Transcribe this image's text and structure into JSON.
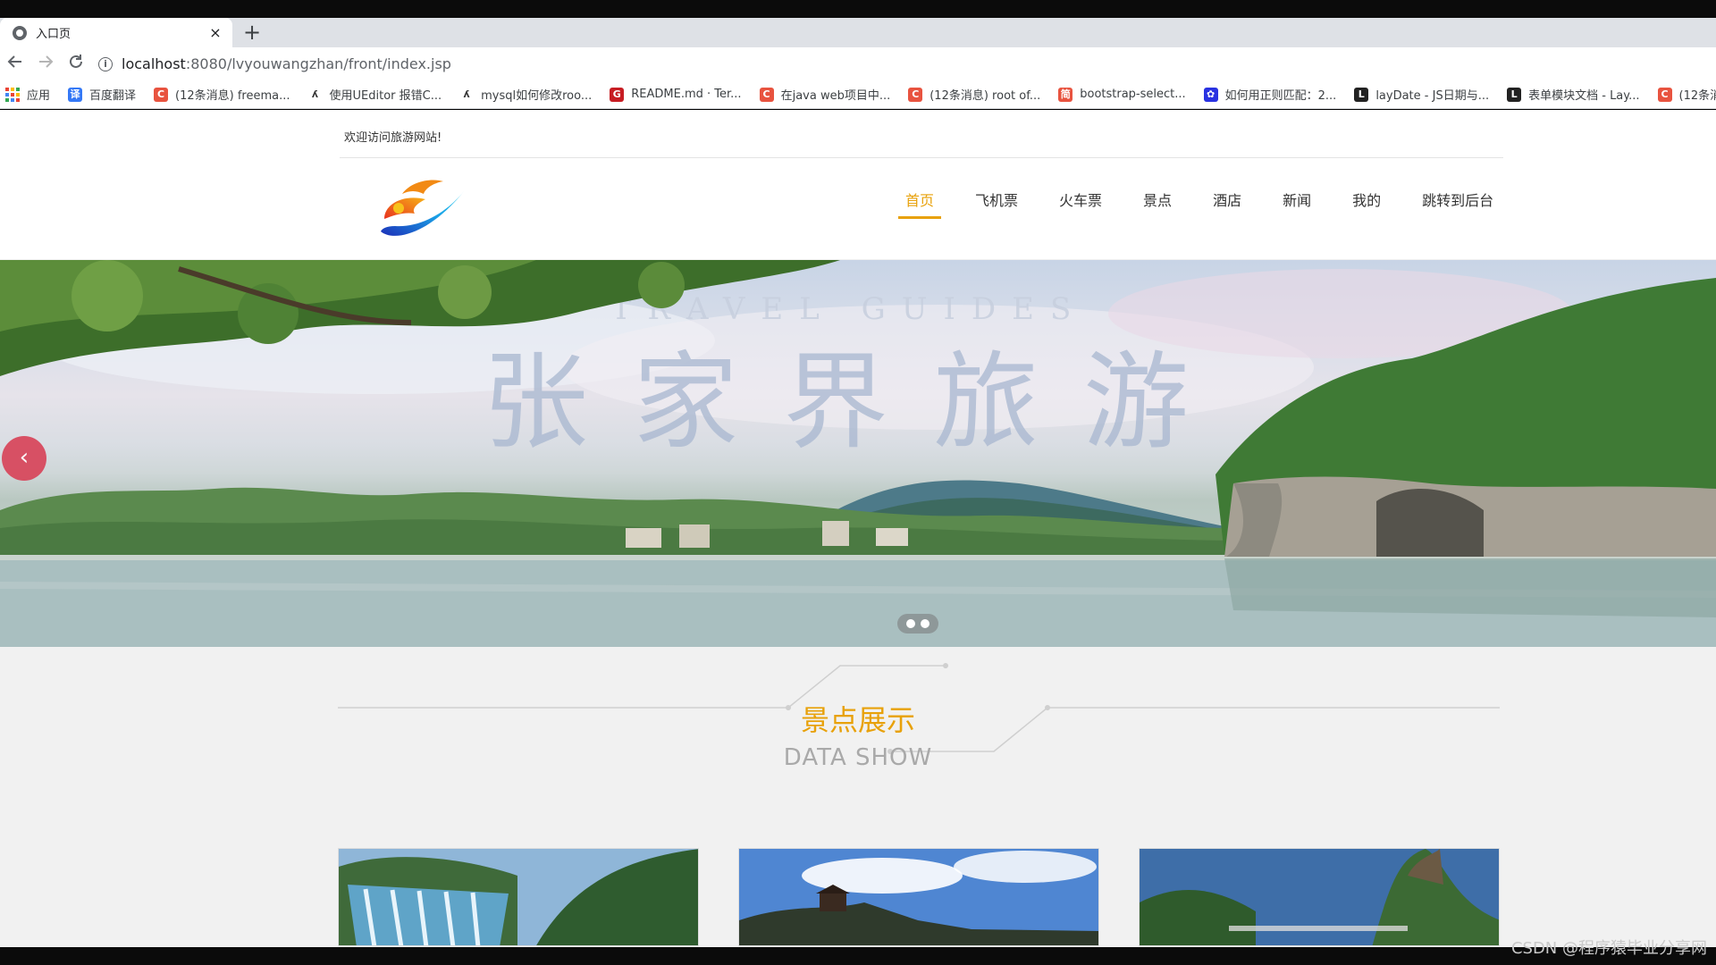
{
  "browser": {
    "tab_title": "入口页",
    "tab_close": "×",
    "new_tab": "+",
    "url_host": "localhost",
    "url_path": ":8080/lvyouwangzhan/front/index.jsp",
    "bookmarks": [
      {
        "label": "应用",
        "icon": "apps-icon"
      },
      {
        "label": "百度翻译",
        "icon": "baidu-translate-icon",
        "color": "#3478f6",
        "glyph": "译"
      },
      {
        "label": "(12条消息) freema...",
        "icon": "csdn-icon",
        "color": "#e8533f",
        "glyph": "C"
      },
      {
        "label": "使用UEditor 报错C...",
        "icon": "blog-icon",
        "color": "#ffffff",
        "glyph": "ʎ"
      },
      {
        "label": "mysql如何修改roo...",
        "icon": "blog-icon",
        "color": "#ffffff",
        "glyph": "ʎ"
      },
      {
        "label": "README.md · Ter...",
        "icon": "gitee-icon",
        "color": "#c71d23",
        "glyph": "G"
      },
      {
        "label": "在java web项目中...",
        "icon": "csdn-icon",
        "color": "#e8533f",
        "glyph": "C"
      },
      {
        "label": "(12条消息) root of...",
        "icon": "csdn-icon",
        "color": "#e8533f",
        "glyph": "C"
      },
      {
        "label": "bootstrap-select...",
        "icon": "doc-icon",
        "color": "#e8533f",
        "glyph": "简"
      },
      {
        "label": "如何用正则匹配：2...",
        "icon": "baidu-paw-icon",
        "color": "#2932e1",
        "glyph": "✿"
      },
      {
        "label": "layDate - JS日期与...",
        "icon": "layui-icon",
        "color": "#222222",
        "glyph": "L"
      },
      {
        "label": "表单模块文档 - Lay...",
        "icon": "layui-icon",
        "color": "#222222",
        "glyph": "L"
      },
      {
        "label": "(12条消",
        "icon": "csdn-icon",
        "color": "#e8533f",
        "glyph": "C"
      }
    ]
  },
  "site": {
    "welcome": "欢迎访问旅游网站!",
    "nav": [
      "首页",
      "飞机票",
      "火车票",
      "景点",
      "酒店",
      "新闻",
      "我的",
      "跳转到后台"
    ],
    "active_nav": 0,
    "accent_color": "#e8a10a"
  },
  "banner": {
    "title_overlay": "张家界旅游",
    "subtitle_overlay": "TRAVEL GUIDES",
    "prev_glyph": "‹",
    "slide_count": 2
  },
  "section": {
    "title": "景点展示",
    "subtitle": "DATA SHOW"
  },
  "watermark": "CSDN @程序猿毕业分享网"
}
